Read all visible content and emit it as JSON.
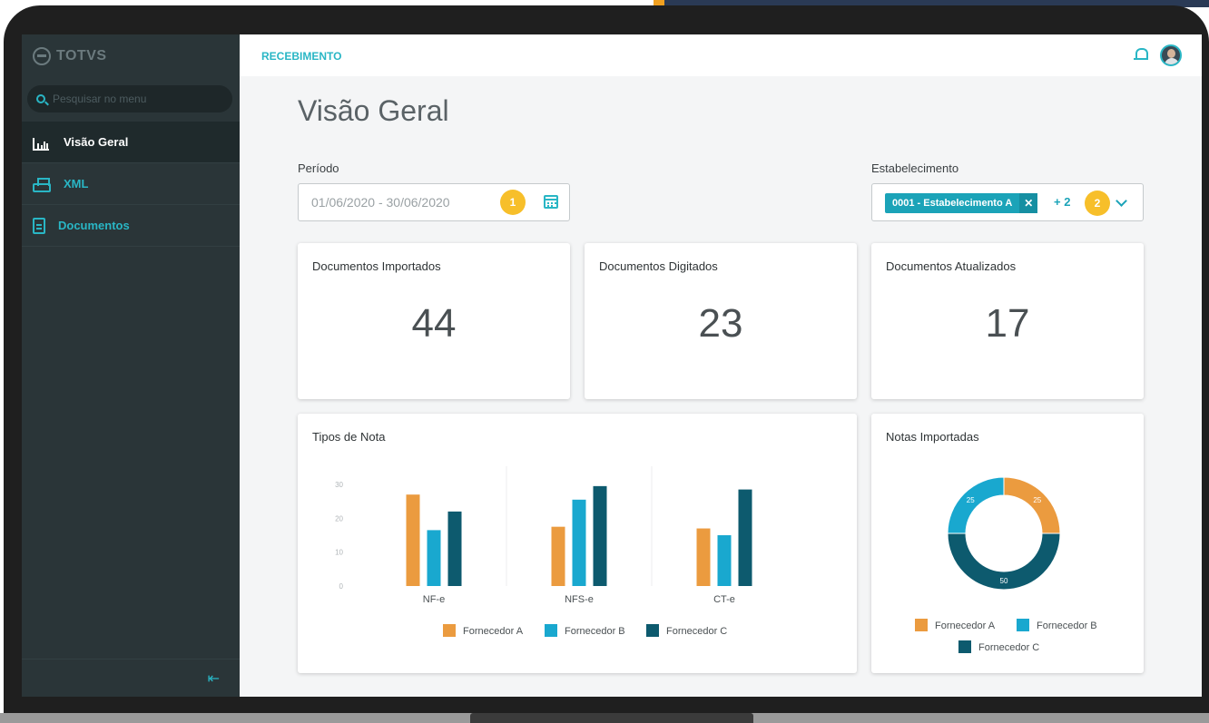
{
  "brand": {
    "logo_text": "TOTVS"
  },
  "sidebar": {
    "search_placeholder": "Pesquisar no menu",
    "items": [
      {
        "label": "Visão Geral",
        "icon": "bar-chart-icon",
        "active": true
      },
      {
        "label": "XML",
        "icon": "printer-icon",
        "active": false
      },
      {
        "label": "Documentos",
        "icon": "document-icon",
        "active": false
      }
    ],
    "collapse_icon": "collapse-menu-icon"
  },
  "header": {
    "module": "RECEBIMENTO",
    "notification_icon": "bell-icon",
    "avatar_icon": "user-avatar-icon"
  },
  "page": {
    "title": "Visão Geral"
  },
  "filters": {
    "period_label": "Período",
    "period_value": "01/06/2020 - 30/06/2020",
    "period_badge": "1",
    "establishment_label": "Estabelecimento",
    "establishment_chip": "0001 - Estabelecimento A",
    "establishment_chip_close": "✕",
    "establishment_more": "+ 2",
    "establishment_badge": "2"
  },
  "kpis": [
    {
      "title": "Documentos Importados",
      "value": "44"
    },
    {
      "title": "Documentos Digitados",
      "value": "23"
    },
    {
      "title": "Documentos Atualizados",
      "value": "17"
    }
  ],
  "colors": {
    "accent": "#29b6c5",
    "sidebar": "#2a3538",
    "supplier_a": "#eb9b3f",
    "supplier_b": "#19a8cf",
    "supplier_c": "#0d5a6e",
    "badge": "#f7bf2a"
  },
  "chart_data": [
    {
      "type": "bar",
      "title": "Tipos de Nota",
      "categories": [
        "NF-e",
        "NFS-e",
        "CT-e"
      ],
      "series": [
        {
          "name": "Fornecedor A",
          "values": [
            27,
            17.5,
            17
          ]
        },
        {
          "name": "Fornecedor B",
          "values": [
            16.5,
            25.5,
            15
          ]
        },
        {
          "name": "Fornecedor C",
          "values": [
            22,
            29.5,
            28.5
          ]
        }
      ],
      "yticks": [
        "0",
        "10",
        "20",
        "30"
      ],
      "ylim": [
        0,
        30
      ],
      "legend_position": "bottom",
      "grid": false
    },
    {
      "type": "pie",
      "title": "Notas Importadas",
      "labels": [
        "Fornecedor A",
        "Fornecedor C",
        "Fornecedor B"
      ],
      "values": [
        25,
        50,
        25
      ],
      "value_labels": [
        "25",
        "50",
        "25"
      ],
      "donut": true,
      "legend_position": "bottom"
    }
  ]
}
